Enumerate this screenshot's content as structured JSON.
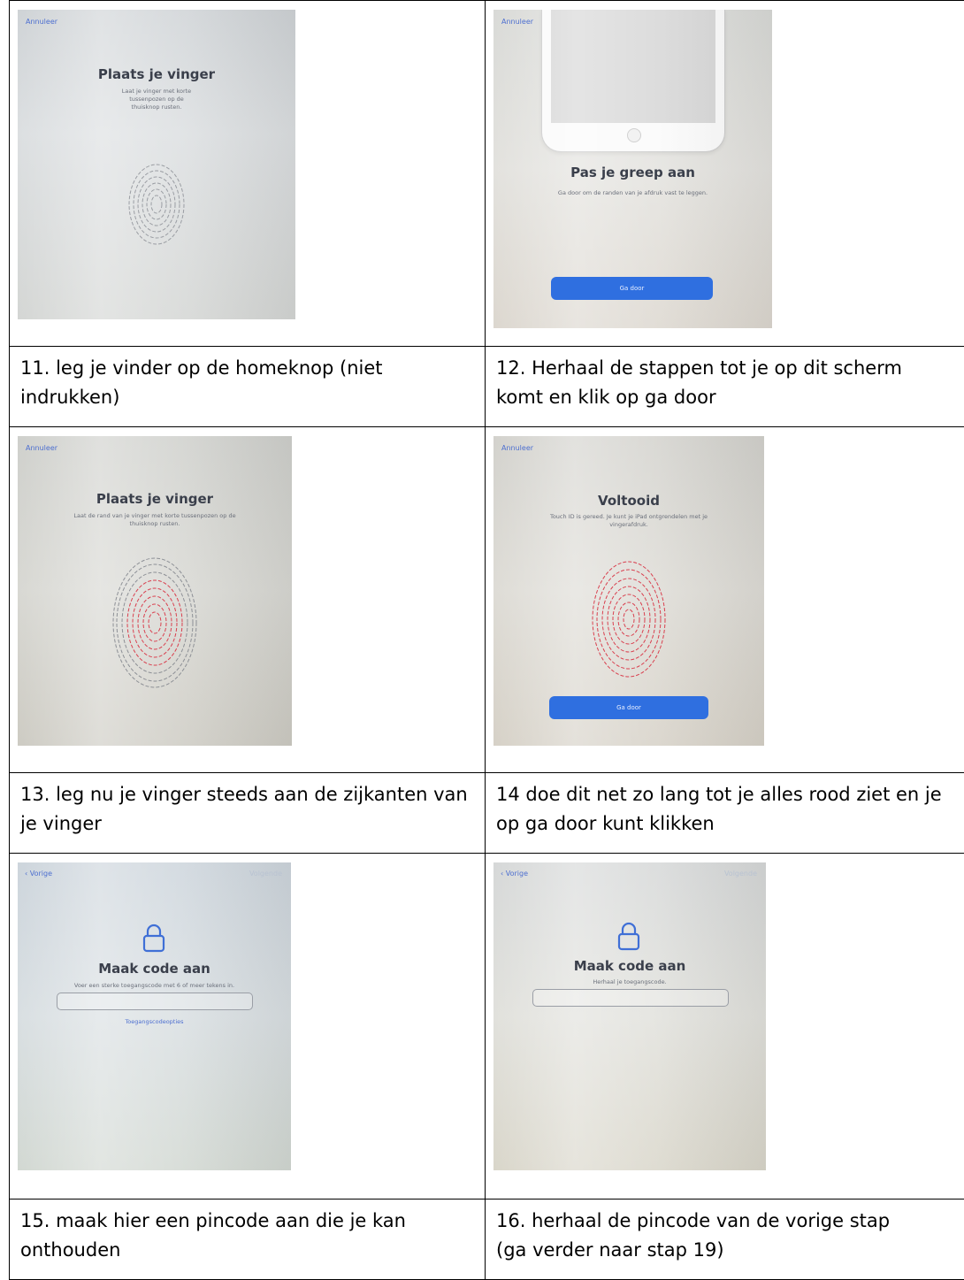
{
  "cells": [
    {
      "cancel": "Annuleer",
      "title": "Plaats je vinger",
      "text": [
        "Laat je vinger met korte",
        "tussenpozen op de",
        "thuisknop rusten."
      ],
      "caption": [
        "11. leg je vinder op de homeknop (niet",
        "indrukken)"
      ]
    },
    {
      "cancel": "Annuleer",
      "title": "Pas je greep aan",
      "text": [
        "Ga door om de randen van je afdruk vast te leggen."
      ],
      "button": "Ga door",
      "caption": [
        "12. Herhaal de stappen tot je op dit scherm",
        "komt en klik op ga door"
      ]
    },
    {
      "cancel": "Annuleer",
      "title": "Plaats je vinger",
      "text": [
        "Laat de rand van je vinger met korte tussenpozen op de",
        "thuisknop rusten."
      ],
      "caption": [
        "13. leg nu je vinger steeds aan de zijkanten van",
        "je vinger"
      ]
    },
    {
      "cancel": "Annuleer",
      "title": "Voltooid",
      "text": [
        "Touch ID is gereed. Je kunt je iPad ontgrendelen met je",
        "vingerafdruk."
      ],
      "button": "Ga door",
      "caption": [
        "14 doe dit net zo lang tot je alles rood ziet en je",
        "op ga door kunt klikken"
      ]
    },
    {
      "back": "Vorige",
      "next": "Volgende",
      "title": "Maak code aan",
      "text": [
        "Voer een sterke toegangscode met 6 of meer tekens in."
      ],
      "link": "Toegangscodeopties",
      "caption": [
        "15. maak hier een pincode aan die je kan",
        "onthouden"
      ]
    },
    {
      "back": "Vorige",
      "next": "Volgende",
      "title": "Maak code aan",
      "text": [
        "Herhaal je toegangscode."
      ],
      "caption": [
        "16. herhaal de pincode van de vorige stap",
        "(ga verder naar stap 19)"
      ]
    }
  ],
  "colors": {
    "accent": "#2f6fe0",
    "link": "#4d6fd0",
    "fingerprint_gray": "#8d9096",
    "fingerprint_red": "#d9404f",
    "border": "#000000"
  },
  "icons": {
    "fingerprint": "fingerprint-icon",
    "lock": "lock-icon",
    "back": "chevron-left-icon"
  }
}
